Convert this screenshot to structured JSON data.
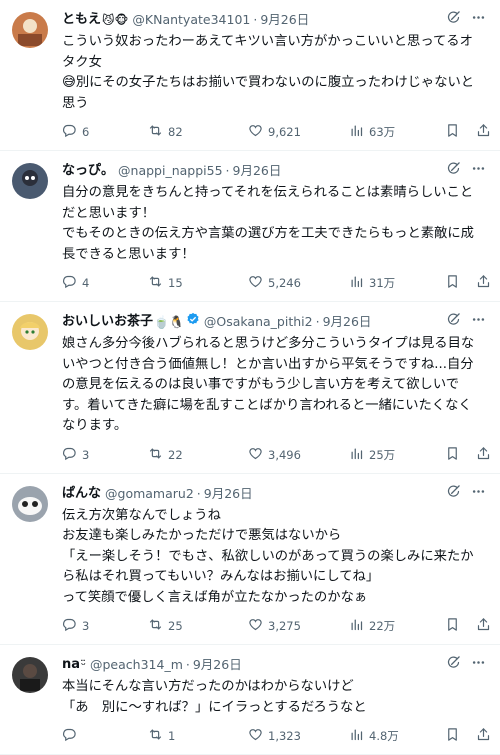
{
  "tweets": [
    {
      "name": "ともえ",
      "emoji": "😼🐵",
      "handle": "@KNantyate34101",
      "date": "9月26日",
      "verified": false,
      "text": "こういう奴おったわーあえてキツい言い方がかっこいいと思ってるオタク女\n😅別にその女子たちはお揃いで買わないのに腹立ったわけじゃないと思う",
      "replies": "6",
      "retweets": "82",
      "likes": "9,621",
      "views": "63万",
      "avatar_color": "#c97b4a"
    },
    {
      "name": "なっぴ。",
      "emoji": "",
      "handle": "@nappi_nappi55",
      "date": "9月26日",
      "verified": false,
      "text": "自分の意見をきちんと持ってそれを伝えられることは素晴らしいことだと思います！\nでもそのときの伝え方や言葉の選び方を工夫できたらもっと素敵に成長できると思います！",
      "replies": "4",
      "retweets": "15",
      "likes": "5,246",
      "views": "31万",
      "avatar_color": "#4a5a70"
    },
    {
      "name": "おいしいお茶子",
      "emoji": "🍵🐧",
      "handle": "@Osakana_pithi2",
      "date": "9月26日",
      "verified": true,
      "text": "娘さん多分今後ハブられると思うけど多分こういうタイプは見る目ないやつと付き合う価値無し！とか言い出すから平気そうですね...自分の意見を伝えるのは良い事ですがもう少し言い方を考えて欲しいです。着いてきた癖に場を乱すことばかり言われると一緒にいたくなくなります。",
      "replies": "3",
      "retweets": "22",
      "likes": "3,496",
      "views": "25万",
      "avatar_color": "#e8c76a"
    },
    {
      "name": "ぱんな",
      "emoji": "",
      "handle": "@gomamaru2",
      "date": "9月26日",
      "verified": false,
      "text": "伝え方次第なんでしょうね\nお友達も楽しみたかっただけで悪気はないから\n「えー楽しそう！でもさ、私欲しいのがあって買うの楽しみに来たから私はそれ買ってもいい？みんなはお揃いにしてね」\nって笑顔で優しく言えば角が立たなかったのかなぁ",
      "replies": "3",
      "retweets": "25",
      "likes": "3,275",
      "views": "22万",
      "avatar_color": "#9aa3ad"
    },
    {
      "name": "na",
      "emoji": "ᵕ̈",
      "handle": "@peach314_m",
      "date": "9月26日",
      "verified": false,
      "text": "本当にそんな言い方だったのかはわからないけど\n「あ　別に〜すれば？」にイラっとするだろうなと",
      "replies": "",
      "retweets": "1",
      "likes": "1,323",
      "views": "4.8万",
      "avatar_color": "#3a3a3a"
    }
  ],
  "colors": {
    "muted": "#536471",
    "verified": "#1d9bf0"
  }
}
